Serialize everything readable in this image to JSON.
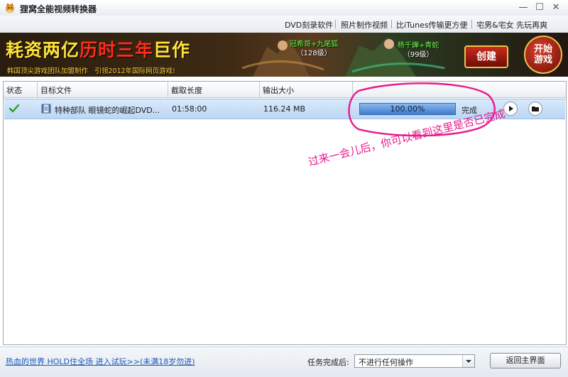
{
  "window": {
    "title": "狸窝全能视频转换器",
    "controls": {
      "minimize": "—",
      "maximize": "☐",
      "close": "✕"
    }
  },
  "links": [
    {
      "label": "DVD刻录软件"
    },
    {
      "label": "照片制作视频"
    },
    {
      "label": "比iTunes传输更方便"
    },
    {
      "label": "宅男&宅女 先玩再爽"
    }
  ],
  "banner": {
    "headline_part1": "耗资两亿",
    "headline_part2": "历时三年",
    "headline_part3": "巨作",
    "subline": "韩国顶尖游戏团队加盟制作　引领2012年国际网页游戏!",
    "character_a_name": "冠希哥+九尾狐",
    "character_a_level": "（128级）",
    "character_b_name": "杨千嬅+青蛇",
    "character_b_level": "（99级）",
    "create_label": "创建",
    "start_line1": "开始",
    "start_line2": "游戏"
  },
  "table": {
    "columns": {
      "status": "状态",
      "target": "目标文件",
      "duration": "截取长度",
      "output_size": "输出大小"
    },
    "rows": [
      {
        "file_name": "特种部队 眼镜蛇的崛起DVD...",
        "duration": "01:58:00",
        "size": "116.24 MB",
        "progress_text": "100.00%",
        "progress_fraction": 1.0,
        "status_text": "完成"
      }
    ]
  },
  "annotation": {
    "text": "过来一会儿后，你可以看到这里是否已完成",
    "color": "#e8198c"
  },
  "footer": {
    "promo_link": "热血的世界 HOLD住全场 进入试玩>>(未满18岁勿进)",
    "after_task_label": "任务完成后:",
    "after_task_value": "不进行任何操作",
    "main_button": "返回主界面"
  },
  "colors": {
    "selection": "#bcd6f3",
    "progress_fill": "#3f7bd1",
    "link": "#1b58b8"
  }
}
